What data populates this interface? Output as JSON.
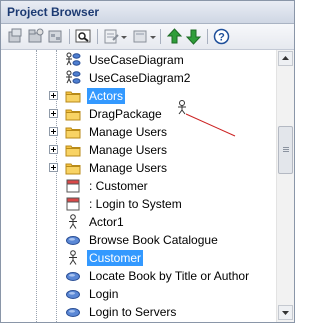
{
  "window": {
    "title": "Project Browser"
  },
  "toolbar": {
    "buttons": [
      {
        "icon": "new-model-icon"
      },
      {
        "icon": "add-package-icon"
      },
      {
        "icon": "add-diagram-icon"
      },
      {
        "icon": "find-icon"
      },
      {
        "icon": "new-element-icon"
      },
      {
        "icon": "dropdown-icon"
      },
      {
        "icon": "move-up-icon"
      },
      {
        "icon": "move-down-icon"
      },
      {
        "icon": "help-icon"
      }
    ]
  },
  "tree": {
    "items": [
      {
        "label": "UseCaseDiagram",
        "icon": "usecase-diagram-icon",
        "expander": false,
        "selected": false
      },
      {
        "label": "UseCaseDiagram2",
        "icon": "usecase-diagram-icon",
        "expander": false,
        "selected": false
      },
      {
        "label": "Actors",
        "icon": "folder-icon",
        "expander": true,
        "selected": true
      },
      {
        "label": "DragPackage",
        "icon": "folder-icon",
        "expander": true,
        "selected": false
      },
      {
        "label": "Manage Users",
        "icon": "folder-icon",
        "expander": true,
        "selected": false
      },
      {
        "label": "Manage Users",
        "icon": "folder-icon",
        "expander": true,
        "selected": false
      },
      {
        "label": "Manage Users",
        "icon": "folder-icon",
        "expander": true,
        "selected": false
      },
      {
        "label": ": Customer",
        "icon": "object-icon",
        "expander": false,
        "selected": false
      },
      {
        "label": ": Login to System",
        "icon": "object-icon",
        "expander": false,
        "selected": false
      },
      {
        "label": "Actor1",
        "icon": "actor-icon",
        "expander": false,
        "selected": false
      },
      {
        "label": "Browse Book Catalogue",
        "icon": "usecase-icon",
        "expander": false,
        "selected": false
      },
      {
        "label": "Customer",
        "icon": "actor-icon",
        "expander": false,
        "selected": true
      },
      {
        "label": "Locate Book by Title or Author",
        "icon": "usecase-icon",
        "expander": false,
        "selected": false
      },
      {
        "label": "Login",
        "icon": "usecase-icon",
        "expander": false,
        "selected": false
      },
      {
        "label": "Login to Servers",
        "icon": "usecase-icon",
        "expander": false,
        "selected": false
      }
    ]
  },
  "drag_cursor": {
    "icon": "actor-drag-icon"
  },
  "colors": {
    "selection": "#3399ff",
    "title_text": "#1c3a72",
    "folder": "#f5c242",
    "usecase": "#4f7fd0",
    "arrow_green": "#2f9e3a"
  }
}
